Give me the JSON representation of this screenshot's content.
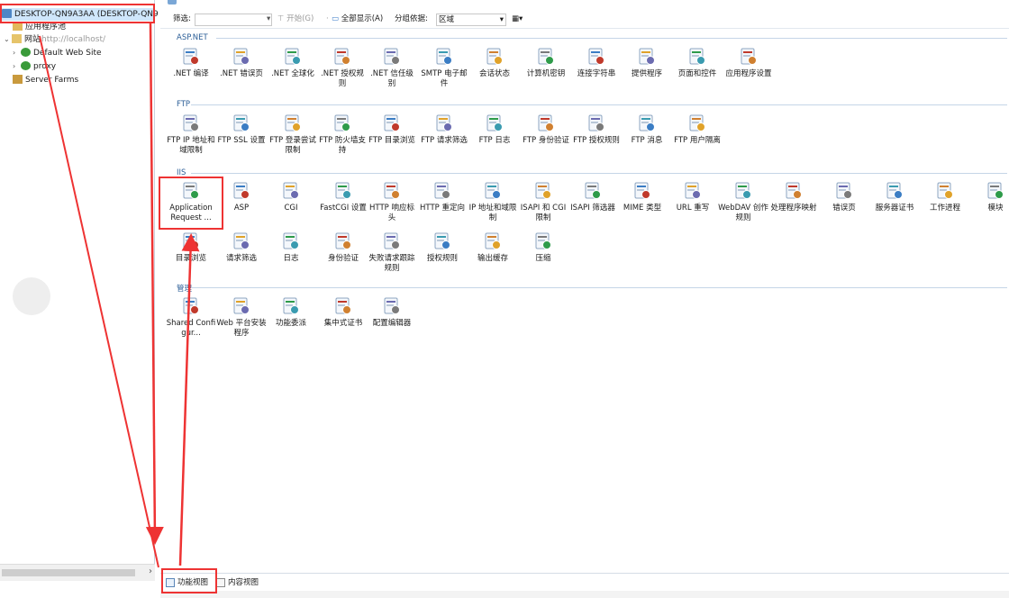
{
  "tree": {
    "root_label": "DESKTOP-QN9A3AA (DESKTOP-QN9",
    "items": [
      {
        "label": "应用程序池",
        "indent": 1
      },
      {
        "label": "网站",
        "tooltip": "http://localhost/",
        "indent": 1,
        "expanded": true
      },
      {
        "label": "Default Web Site",
        "indent": 2
      },
      {
        "label": "proxy",
        "indent": 2
      },
      {
        "label": "Server Farms",
        "indent": 1
      }
    ]
  },
  "filter": {
    "label": "筛选:",
    "start_label": "开始(G)",
    "show_all_label": "全部显示(A)",
    "group_by_label": "分组依据:",
    "group_by_value": "区域"
  },
  "sections": [
    {
      "name": "ASP.NET",
      "features": [
        {
          "label": ".NET 编译",
          "icon": "dotnet-compile-icon"
        },
        {
          "label": ".NET 错误页",
          "icon": "dotnet-error-pages-icon"
        },
        {
          "label": ".NET 全球化",
          "icon": "dotnet-globalization-icon"
        },
        {
          "label": ".NET 授权规则",
          "icon": "dotnet-authorization-icon"
        },
        {
          "label": ".NET 信任级别",
          "icon": "dotnet-trust-level-icon"
        },
        {
          "label": "SMTP 电子邮件",
          "icon": "smtp-email-icon"
        },
        {
          "label": "会话状态",
          "icon": "session-state-icon"
        },
        {
          "label": "计算机密钥",
          "icon": "machine-key-icon"
        },
        {
          "label": "连接字符串",
          "icon": "connection-strings-icon"
        },
        {
          "label": "提供程序",
          "icon": "providers-icon"
        },
        {
          "label": "页面和控件",
          "icon": "pages-controls-icon"
        },
        {
          "label": "应用程序设置",
          "icon": "app-settings-icon"
        }
      ]
    },
    {
      "name": "FTP",
      "features": [
        {
          "label": "FTP IP 地址和域限制",
          "icon": "ftp-ip-restrictions-icon"
        },
        {
          "label": "FTP SSL 设置",
          "icon": "ftp-ssl-icon"
        },
        {
          "label": "FTP 登录尝试限制",
          "icon": "ftp-logon-attempt-icon"
        },
        {
          "label": "FTP 防火墙支持",
          "icon": "ftp-firewall-icon"
        },
        {
          "label": "FTP 目录浏览",
          "icon": "ftp-directory-browsing-icon"
        },
        {
          "label": "FTP 请求筛选",
          "icon": "ftp-request-filtering-icon"
        },
        {
          "label": "FTP 日志",
          "icon": "ftp-logging-icon"
        },
        {
          "label": "FTP 身份验证",
          "icon": "ftp-authentication-icon"
        },
        {
          "label": "FTP 授权规则",
          "icon": "ftp-authorization-icon"
        },
        {
          "label": "FTP 消息",
          "icon": "ftp-messages-icon"
        },
        {
          "label": "FTP 用户隔离",
          "icon": "ftp-user-isolation-icon"
        }
      ]
    },
    {
      "name": "IIS",
      "features": [
        {
          "label": "Application Request ...",
          "icon": "arr-icon"
        },
        {
          "label": "ASP",
          "icon": "asp-icon"
        },
        {
          "label": "CGI",
          "icon": "cgi-icon"
        },
        {
          "label": "FastCGI 设置",
          "icon": "fastcgi-icon"
        },
        {
          "label": "HTTP 响应标头",
          "icon": "http-response-headers-icon"
        },
        {
          "label": "HTTP 重定向",
          "icon": "http-redirect-icon"
        },
        {
          "label": "IP 地址和域限制",
          "icon": "ip-domain-restrictions-icon"
        },
        {
          "label": "ISAPI 和 CGI 限制",
          "icon": "isapi-cgi-restrictions-icon"
        },
        {
          "label": "ISAPI 筛选器",
          "icon": "isapi-filters-icon"
        },
        {
          "label": "MIME 类型",
          "icon": "mime-types-icon"
        },
        {
          "label": "URL 重写",
          "icon": "url-rewrite-icon"
        },
        {
          "label": "WebDAV 创作规则",
          "icon": "webdav-icon"
        },
        {
          "label": "处理程序映射",
          "icon": "handler-mappings-icon"
        },
        {
          "label": "错误页",
          "icon": "error-pages-icon"
        },
        {
          "label": "服务器证书",
          "icon": "server-certificates-icon"
        },
        {
          "label": "工作进程",
          "icon": "worker-processes-icon"
        },
        {
          "label": "模块",
          "icon": "modules-icon"
        },
        {
          "label": "目录浏览",
          "icon": "directory-browsing-icon"
        },
        {
          "label": "请求筛选",
          "icon": "request-filtering-icon"
        },
        {
          "label": "日志",
          "icon": "logging-icon"
        },
        {
          "label": "身份验证",
          "icon": "authentication-icon"
        },
        {
          "label": "失败请求跟踪规则",
          "icon": "failed-request-tracing-icon"
        },
        {
          "label": "授权规则",
          "icon": "authorization-rules-icon"
        },
        {
          "label": "输出缓存",
          "icon": "output-caching-icon"
        },
        {
          "label": "压缩",
          "icon": "compression-icon"
        }
      ]
    },
    {
      "name": "管理",
      "features": [
        {
          "label": "Shared Configur...",
          "icon": "shared-configuration-icon"
        },
        {
          "label": "Web 平台安装程序",
          "icon": "web-platform-installer-icon"
        },
        {
          "label": "功能委派",
          "icon": "feature-delegation-icon"
        },
        {
          "label": "集中式证书",
          "icon": "centralized-certificates-icon"
        },
        {
          "label": "配置编辑器",
          "icon": "configuration-editor-icon"
        }
      ]
    }
  ],
  "bottom_tabs": [
    {
      "label": "功能视图",
      "active": true
    },
    {
      "label": "内容视图",
      "active": false
    }
  ],
  "colors": {
    "selection": "#cfe6fb",
    "section_header": "#2b5e97",
    "annotation": "#e33333"
  }
}
